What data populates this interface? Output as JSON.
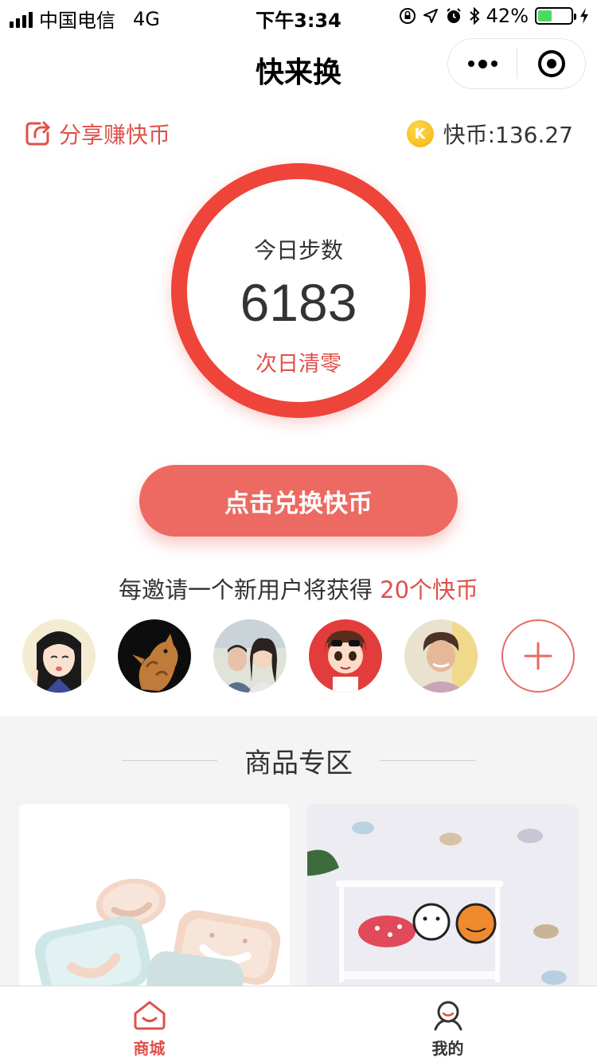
{
  "status_bar": {
    "carrier": "中国电信",
    "network": "4G",
    "time": "下午3:34",
    "battery_percent": "42%",
    "battery_level": 0.42
  },
  "nav": {
    "title": "快来换"
  },
  "share": {
    "label": "分享赚快币",
    "icon": "share-icon"
  },
  "coins": {
    "badge": "K",
    "label": "快币:136.27"
  },
  "steps": {
    "label": "今日步数",
    "value": "6183",
    "note": "次日清零"
  },
  "exchange_button": {
    "label": "点击兑换快币"
  },
  "invite": {
    "text": "每邀请一个新用户将获得 ",
    "reward": "20个快币"
  },
  "avatars": [
    {
      "name": "avatar-anime-girl"
    },
    {
      "name": "avatar-cat"
    },
    {
      "name": "avatar-couple"
    },
    {
      "name": "avatar-cartoon-boy"
    },
    {
      "name": "avatar-woman"
    }
  ],
  "goods": {
    "title": "商品专区"
  },
  "tabs": [
    {
      "label": "商城",
      "icon": "shop-icon",
      "active": true
    },
    {
      "label": "我的",
      "icon": "user-icon",
      "active": false
    }
  ],
  "colors": {
    "accent": "#ee443a",
    "button": "#ec6a62",
    "text_highlight": "#e0504a"
  }
}
